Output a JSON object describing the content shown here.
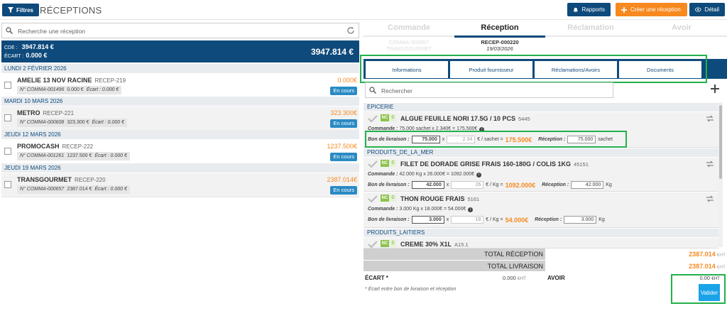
{
  "header": {
    "filtres_label": "Filtres",
    "title": "RÉCEPTIONS",
    "rapports_label": "Rapports",
    "creer_label": "Créer une réception",
    "detail_label": "Détail"
  },
  "left": {
    "search_placeholder": "Recherche une réception",
    "summary": {
      "cde_label": "CDE :",
      "cde_value": "3947.814 €",
      "ecart_label": "ÉCART :",
      "ecart_value": "0.000 €",
      "total": "3947.814 €"
    },
    "groups": [
      {
        "date": "LUNDI 2 FÉVRIER 2026",
        "items": [
          {
            "name": "AMELIE 13 NOV RACINE",
            "ref": "RECEP-219",
            "commande": "N° COMMA-001496",
            "montant": "0.000 €",
            "ecart": "Écart : 0.000 €",
            "amount": "0.000€",
            "status": "En cours"
          }
        ]
      },
      {
        "date": "MARDI 10 MARS 2026",
        "items": [
          {
            "name": "METRO",
            "ref": "RECEP-221",
            "commande": "N° COMMA-000608",
            "montant": "323.300 €",
            "ecart": "Écart : 0.000 €",
            "amount": "323.300€",
            "status": "En cours"
          }
        ]
      },
      {
        "date": "JEUDI 12 MARS 2026",
        "items": [
          {
            "name": "PROMOCASH",
            "ref": "RECEP-222",
            "commande": "N° COMMA-001261",
            "montant": "1237.500 €",
            "ecart": "Écart : 0.000 €",
            "amount": "1237.500€",
            "status": "En cours"
          }
        ]
      },
      {
        "date": "JEUDI 19 MARS 2026",
        "items": [
          {
            "name": "TRANSGOURMET",
            "ref": "RECEP-220",
            "commande": "N° COMMA-000657",
            "montant": "2387.014 €",
            "ecart": "Écart : 0.000 €",
            "amount": "2387.014€",
            "status": "En cours"
          }
        ]
      }
    ]
  },
  "right": {
    "tabs": [
      {
        "label": "Commande",
        "sub1": "COMMA-000657",
        "sub2": "TRANSGOURMET"
      },
      {
        "label": "Réception",
        "sub1": "RECEP-000220",
        "sub2": "19/03/2026"
      },
      {
        "label": "Réclamation",
        "sub1": "",
        "sub2": ""
      },
      {
        "label": "Avoir",
        "sub1": "",
        "sub2": ""
      }
    ],
    "subtabs": [
      "Informations",
      "Produit fournisseur",
      "Réclamations/Avoirs",
      "Documents"
    ],
    "search_placeholder": "Rechercher",
    "categories": [
      "EPICERIE",
      "PRODUITS_DE_LA_MER",
      "PRODUITS_LAITIERS"
    ],
    "labels": {
      "commande": "Commande :",
      "bon_livraison": "Bon de livraison :",
      "reception": "Réception :",
      "times": "x",
      "nc": "NC",
      "zero": "0"
    },
    "products": [
      {
        "name": "ALGUE FEUILLE NORI 17.5G / 10 PCS",
        "code": "5445",
        "commande": "75.000 sachet x 2.340€ = 175.500€",
        "bl_qty": "75.000",
        "bl_price": "2.34",
        "unit_label": "€ / sachet =",
        "bl_total": "175.500€",
        "reception_qty": "75.000",
        "reception_unit": "sachet"
      },
      {
        "name": "FILET DE DORADE GRISE FRAIS 160-180G / COLIS 1KG",
        "code": "45151",
        "commande": "42.000 Kg x 26.000€ = 1092.000€",
        "bl_qty": "42.000",
        "bl_price": "26",
        "unit_label": "€ / Kg =",
        "bl_total": "1092.000€",
        "reception_qty": "42.000",
        "reception_unit": "Kg"
      },
      {
        "name": "THON ROUGE FRAIS",
        "code": "5161",
        "commande": "3.000 Kg x 18.000€ = 54.000€",
        "bl_qty": "3.000",
        "bl_price": "18",
        "unit_label": "€ / Kg =",
        "bl_total": "54.000€",
        "reception_qty": "3.000",
        "reception_unit": "Kg"
      },
      {
        "name": "CREME 30% X1L",
        "code": "A15.1"
      }
    ],
    "totals": {
      "reception_label": "TOTAL RÉCEPTION",
      "reception_value": "2387.014",
      "livraison_label": "TOTAL LIVRAISON",
      "livraison_value": "2387.014",
      "unit": "€HT"
    },
    "ecart_label": "ÉCART *",
    "ecart_value": "0.000",
    "avoir_label": "AVOIR",
    "avoir_value": "0.00",
    "note": "* Écart entre bon de livraison et réception",
    "valider_label": "Valider"
  },
  "colors": {
    "navy": "#0e4a7b",
    "orange": "#f7891f",
    "blue_badge": "#2a8ac4",
    "green_highlight": "#22b14c",
    "valider_blue": "#1aa3e8"
  }
}
